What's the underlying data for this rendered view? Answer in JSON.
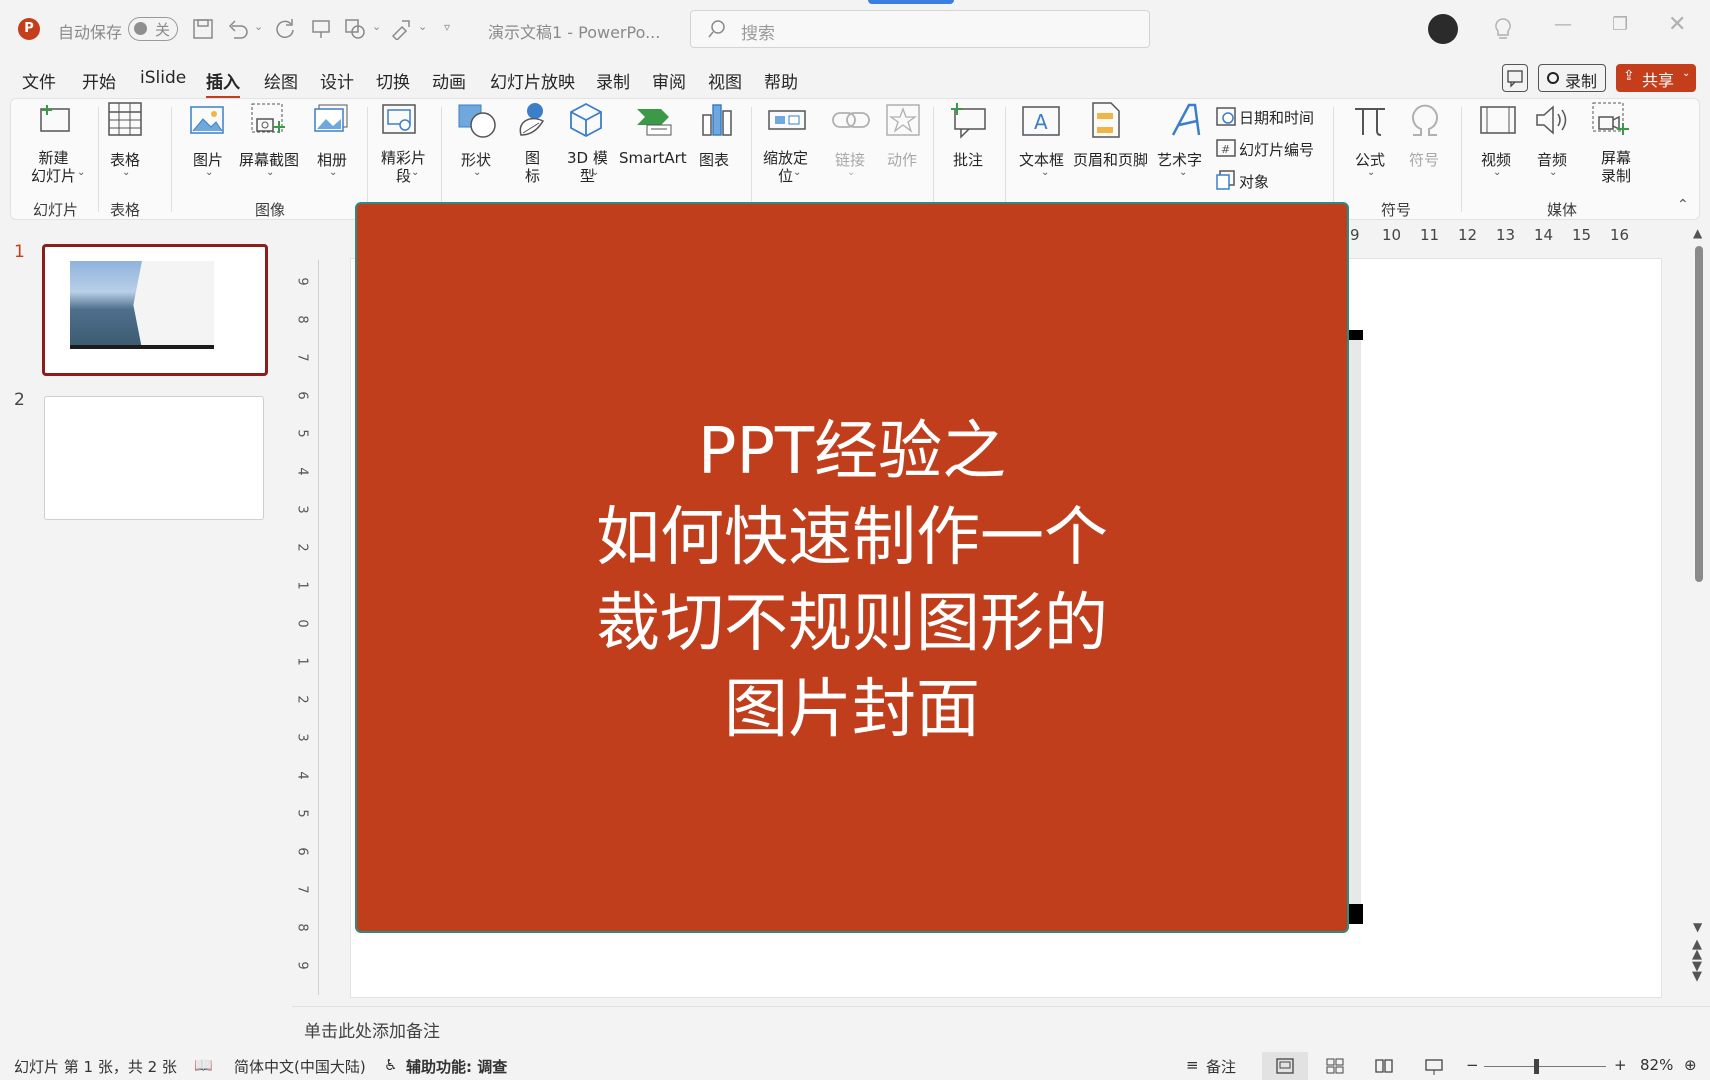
{
  "titlebar": {
    "autosave_label": "自动保存",
    "autosave_state": "关",
    "doc_title": "演示文稿1 - PowerPo...",
    "search_placeholder": "搜索"
  },
  "tabs": [
    "文件",
    "开始",
    "iSlide",
    "插入",
    "绘图",
    "设计",
    "切换",
    "动画",
    "幻灯片放映",
    "录制",
    "审阅",
    "视图",
    "帮助"
  ],
  "active_tab": "插入",
  "actions": {
    "record": "录制",
    "share": "共享"
  },
  "ribbon": {
    "new_slide": "新建\n幻灯片",
    "table": "表格",
    "picture": "图片",
    "screenshot": "屏幕截图",
    "album": "相册",
    "clip": "精彩片\n段",
    "shapes": "形状",
    "icons": "图\n标",
    "model3d": "3D 模\n型",
    "smartart": "SmartArt",
    "chart": "图表",
    "zoom": "缩放定\n位",
    "link": "链接",
    "action": "动作",
    "comment": "批注",
    "textbox": "文本框",
    "header_footer": "页眉和页脚",
    "wordart": "艺术字",
    "datetime": "日期和时间",
    "slide_number": "幻灯片编号",
    "object": "对象",
    "equation": "公式",
    "symbol": "符号",
    "video": "视频",
    "audio": "音频",
    "screen_record": "屏幕\n录制",
    "groups": {
      "slides": "幻灯片",
      "tables": "表格",
      "images": "图像",
      "symbols": "符号",
      "media": "媒体"
    }
  },
  "slides_panel": {
    "items": [
      {
        "num": "1"
      },
      {
        "num": "2"
      }
    ]
  },
  "slide": {
    "title": "PPT经验之\n如何快速制作一个\n裁切不规则图形的\n图片封面",
    "bg_color": "#c13e1c"
  },
  "ruler_h": [
    "9",
    "10",
    "11",
    "12",
    "13",
    "14",
    "15",
    "16"
  ],
  "ruler_v": [
    "9",
    "8",
    "7",
    "6",
    "5",
    "4",
    "3",
    "2",
    "1",
    "0",
    "1",
    "2",
    "3",
    "4",
    "5",
    "6",
    "7",
    "8",
    "9"
  ],
  "notes_placeholder": "单击此处添加备注",
  "status": {
    "slide_info": "幻灯片 第 1 张，共 2 张",
    "language": "简体中文(中国大陆)",
    "accessibility": "辅助功能: 调查",
    "notes": "备注",
    "zoom": "82%"
  }
}
